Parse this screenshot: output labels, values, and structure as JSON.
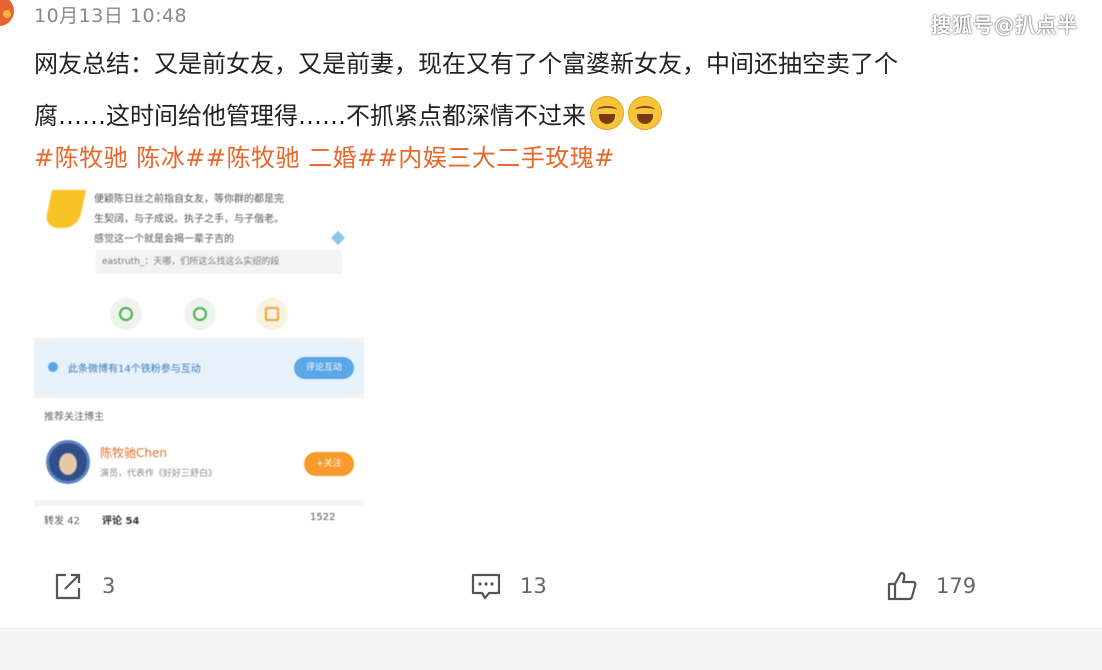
{
  "post": {
    "timestamp": "10月13日 10:48",
    "text_line1": "网友总结：又是前女友，又是前妻，现在又有了个富婆新女友，中间还抽空卖了个",
    "text_line2": "腐……这时间给他管理得……不抓紧点都深情不过来",
    "emojis": [
      "crying-laughing-emoji",
      "crying-laughing-emoji"
    ],
    "hashtags": "#陈牧驰 陈冰##陈牧驰 二婚##内娱三大二手玫瑰#"
  },
  "watermark": "搜狐号@扒点半",
  "embedded_screenshot": {
    "quote_lines": [
      "便颖陈日丝之前指自女友，等你群的都是完",
      "生契阔，与子成说。执子之手，与子偕老。",
      "感觉这一个就是会揭一辈子吉的"
    ],
    "comment_preview": "eastruth_：天哪，们所这么找这么实绍的段",
    "interaction_text": "此条微博有14个铁粉参与互动",
    "interaction_button": "评论互动",
    "recommend_label": "推荐关注博主",
    "user_name": "陈牧驰Chen",
    "user_desc": "演员，代表作《好好三舒白》",
    "follow_button": "+关注",
    "stats": {
      "reposts": "转发 42",
      "comments": "评论 54",
      "likes": "1522"
    }
  },
  "actions": {
    "share_count": "3",
    "comment_count": "13",
    "like_count": "179"
  },
  "colors": {
    "hashtag": "#e8672a",
    "timestamp": "#8a8a8a",
    "follow_button": "#f89a2a",
    "info_bar": "#e7f1fa"
  }
}
